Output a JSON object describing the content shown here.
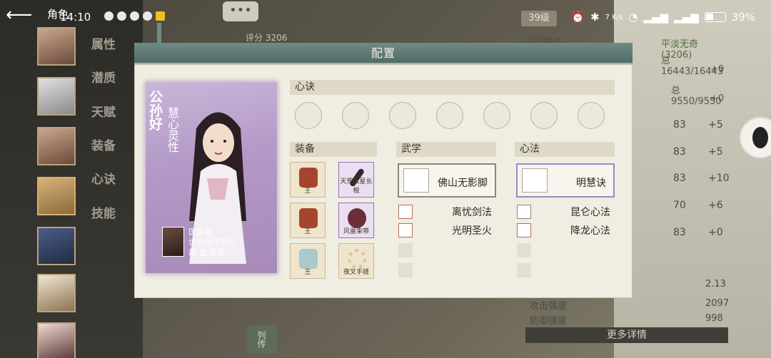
{
  "status": {
    "time": "14:10",
    "net": "7 K/s",
    "battery": "39%"
  },
  "header": {
    "title": "角色"
  },
  "sidebar": {
    "menu": [
      "属性",
      "潜质",
      "天赋",
      "装备",
      "心诀",
      "技能"
    ],
    "bottom_label": "列传"
  },
  "background": {
    "score": "评分 3206",
    "level": "39级",
    "base_attr": "基础属性",
    "rank": "平淡无奇(3206)",
    "hp": "总16443/16443",
    "mp": "总9550/9550",
    "rows": [
      {
        "val": "83",
        "inc": "+5"
      },
      {
        "val": "83",
        "inc": "+5"
      },
      {
        "val": "83",
        "inc": "+10"
      },
      {
        "val": "70",
        "inc": "+6"
      },
      {
        "val": "83",
        "inc": "+0"
      }
    ],
    "plus_a": "+0",
    "plus_b": "+0",
    "crit": "2.13",
    "attack_label": "攻击强度",
    "attack_value": "2097",
    "defense_label": "防御强度",
    "defense_value": "998",
    "more_label": "更多详情"
  },
  "modal": {
    "title": "配置",
    "character": {
      "name": "公孙好",
      "trait": "慧心灵性",
      "owner_name": "匡英卓",
      "owner_score": "论剑分 1500",
      "owner_guild": "帮  会 暂无"
    },
    "xinjue_label": "心诀",
    "equip_label": "装备",
    "equipment": [
      {
        "name": "王",
        "quality": "gold"
      },
      {
        "name": "天荒玄星长棍",
        "quality": "purple"
      },
      {
        "name": "王",
        "quality": "gold"
      },
      {
        "name": "风雷束带",
        "quality": "purple"
      },
      {
        "name": "王",
        "quality": "gold"
      },
      {
        "name": "夜叉手链",
        "quality": "gold"
      }
    ],
    "martial_label": "武学",
    "martial_main": "佛山无影脚",
    "martial_skills": [
      "离忧剑法",
      "光明圣火"
    ],
    "xinfa_label": "心法",
    "xinfa_main": "明慧诀",
    "xinfa_skills": [
      "昆仑心法",
      "降龙心法"
    ]
  }
}
